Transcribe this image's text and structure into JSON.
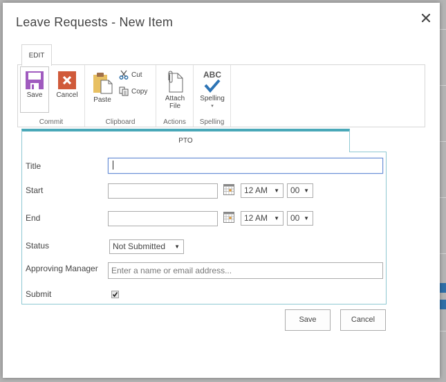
{
  "dialog": {
    "title": "Leave Requests - New Item",
    "close_icon": "close-icon"
  },
  "ribbon": {
    "active_tab": "EDIT",
    "groups": [
      {
        "label": "Commit",
        "buttons": [
          {
            "label": "Save",
            "icon": "floppy-disk-icon",
            "color": "#a05bbf"
          },
          {
            "label": "Cancel",
            "icon": "cancel-x-icon",
            "color": "#d05a3a"
          }
        ]
      },
      {
        "label": "Clipboard",
        "buttons": [
          {
            "label": "Paste",
            "icon": "clipboard-paste-icon",
            "color": "#e8c062"
          },
          {
            "label": "Cut",
            "icon": "scissors-icon",
            "color": "#2d6fa8"
          },
          {
            "label": "Copy",
            "icon": "copy-icon",
            "color": "#555555"
          }
        ]
      },
      {
        "label": "Actions",
        "buttons": [
          {
            "label": "Attach",
            "label2": "File",
            "icon": "attach-file-icon"
          }
        ]
      },
      {
        "label": "Spelling",
        "buttons": [
          {
            "label": "Spelling",
            "icon": "spelling-check-icon",
            "icon_text": "ABC",
            "color": "#2d74b5"
          }
        ]
      }
    ]
  },
  "form": {
    "tab_label": "PTO",
    "accent_color": "#49a8b8",
    "fields": {
      "title": {
        "label": "Title",
        "value": ""
      },
      "start": {
        "label": "Start",
        "date": "",
        "hour": "12 AM",
        "minute": "00"
      },
      "end": {
        "label": "End",
        "date": "",
        "hour": "12 AM",
        "minute": "00"
      },
      "status": {
        "label": "Status",
        "value": "Not Submitted"
      },
      "approving_manager": {
        "label": "Approving Manager",
        "placeholder": "Enter a name or email address..."
      },
      "submit": {
        "label": "Submit",
        "checked": true
      }
    }
  },
  "footer": {
    "save_label": "Save",
    "cancel_label": "Cancel"
  }
}
